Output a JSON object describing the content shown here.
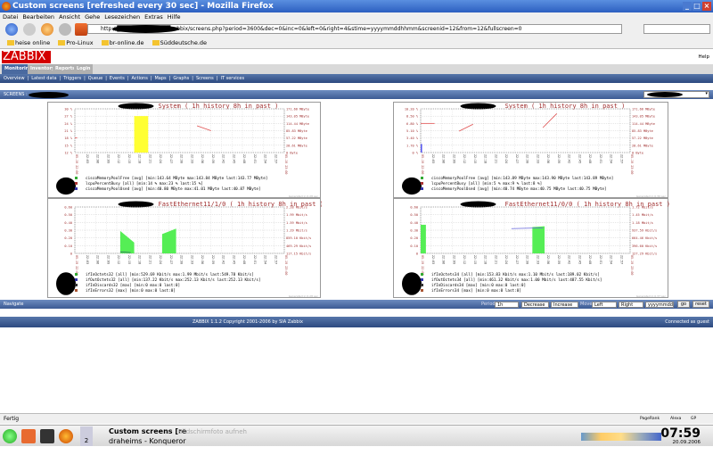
{
  "window": {
    "title": "Custom screens [refreshed every 30 sec] - Mozilla Firefox",
    "minimize": "_",
    "maximize": "□",
    "close": "×"
  },
  "menu": [
    "Datei",
    "Bearbeiten",
    "Ansicht",
    "Gehe",
    "Lesezeichen",
    "Extras",
    "Hilfe"
  ],
  "url": "http://█████████████zabbix/screens.php?period=3600&dec=0&inc=0&left=0&right=4&stime=yyyymmddhhmm&screenid=12&from=12&fullscreen=0",
  "bookmarks": [
    "heise online",
    "Pro-Linux",
    "br-online.de",
    "Süddeutsche.de"
  ],
  "zabbix": {
    "logo": "ZABBIX",
    "help": "Help",
    "tabs": [
      "Monitoring",
      "Inventory",
      "Reports",
      "Login"
    ],
    "submenu": [
      "Overview",
      "Latest data",
      "Triggers",
      "Queue",
      "Events",
      "Actions",
      "Maps",
      "Graphs",
      "Screens",
      "IT services"
    ],
    "screens_label": "SCREENS :",
    "navigate": "Navigate",
    "period_label": "Period",
    "period": "1h",
    "decrease": "Decrease",
    "increase": "Increase",
    "move_label": "Move",
    "left": "Left",
    "right": "Right",
    "stime": "yyyymmddhhmm",
    "go": "go",
    "reset": "reset",
    "footer": "ZABBIX 1.1.2 Copyright 2001-2006 by SIA Zabbix",
    "connected": "Connected as guest"
  },
  "graphs": [
    {
      "title": "System ( 1h history 8h in past )",
      "ylim": [
        12,
        30
      ],
      "left_axis": [
        "30 %",
        "27 %",
        "24 %",
        "21 %",
        "18 %",
        "15 %",
        "12 %"
      ],
      "right_axis": [
        "171.66 MByte",
        "143.05 MByte",
        "114.44 MByte",
        "85.83 MByte",
        "57.22 MByte",
        "28.61 MByte",
        "0 Byte"
      ],
      "x_start": "05.19 22:00",
      "x_end": "05.19 23:00",
      "marks": [
        {
          "kind": "area",
          "color": "#ffff33",
          "points": [
            [
              17,
              27
            ],
            [
              21,
              27
            ]
          ]
        },
        {
          "kind": "line",
          "color": "#e05050",
          "points": [
            [
              35,
              23
            ],
            [
              39,
              21
            ]
          ]
        },
        {
          "kind": "line",
          "color": "#e05050",
          "points": [
            [
              0,
              18
            ],
            [
              0.7,
              18
            ]
          ]
        }
      ],
      "legend": [
        {
          "color": "#33aa33",
          "text": "ciscoMemoryPoolFree [avg] [min:143.64 MByte max:143.84 MByte last:143.77 MByte]"
        },
        {
          "color": "#aa3333",
          "text": "lcpuPercentBusy     [all] [min:14 % max:23 % last:15 %]"
        },
        {
          "color": "#3333aa",
          "text": "ciscoMemoryPoolUsed [avg] [min:40.80 MByte max:41.01 MByte last:40.87 MByte]"
        }
      ],
      "generated": "Generated in 0.28 sec"
    },
    {
      "title": "System ( 1h history 8h in past )",
      "ylim": [
        0,
        10.2
      ],
      "left_axis": [
        "10.20 %",
        "8.50 %",
        "6.80 %",
        "5.10 %",
        "3.40 %",
        "1.70 %",
        "0 %"
      ],
      "right_axis": [
        "171.66 MByte",
        "143.05 MByte",
        "114.44 MByte",
        "85.83 MByte",
        "57.22 MByte",
        "28.61 MByte",
        "0 Byte"
      ],
      "x_start": "05.19 22:00",
      "x_end": "05.19 23:00",
      "marks": [
        {
          "kind": "area",
          "color": "#5555ee",
          "points": [
            [
              0,
              2
            ],
            [
              0.4,
              2
            ]
          ]
        },
        {
          "kind": "line",
          "color": "#e05050",
          "points": [
            [
              0,
              6.8
            ],
            [
              4,
              6.8
            ]
          ]
        },
        {
          "kind": "line",
          "color": "#e05050",
          "points": [
            [
              11,
              5
            ],
            [
              15,
              6.6
            ]
          ]
        },
        {
          "kind": "line",
          "color": "#e05050",
          "points": [
            [
              35,
              5.8
            ],
            [
              39,
              9.1
            ]
          ]
        }
      ],
      "legend": [
        {
          "color": "#33aa33",
          "text": "ciscoMemoryPoolFree [avg] [min:143.89 MByte max:143.90 MByte last:143.89 MByte]"
        },
        {
          "color": "#aa3333",
          "text": "lcpuPercentBusy     [all] [min:5 % max:9 % last:8 %]"
        },
        {
          "color": "#3333aa",
          "text": "ciscoMemoryPoolUsed [avg] [min:40.74 MByte max:40.75 MByte last:40.75 MByte]"
        }
      ],
      "generated": "Generated in 0.30 sec"
    },
    {
      "title": "FastEthernet11/1/0 ( 1h history 8h in past )",
      "ylim": [
        0,
        0.6
      ],
      "left_axis": [
        "0.60",
        "0.50",
        "0.40",
        "0.30",
        "0.20",
        "0.10",
        "0"
      ],
      "right_axis": [
        "2.28 Mbit/s",
        "1.99 Mbit/s",
        "1.59 Mbit/s",
        "1.29 Mbit/s",
        "859.10 Kbit/s",
        "469.29 Kbit/s",
        "117.15 Kbit/s"
      ],
      "x_start": "05.19 22:00",
      "x_end": "05.19 23:00",
      "marks": [
        {
          "kind": "area",
          "color": "#55ee55",
          "points": [
            [
              13,
              0.29
            ],
            [
              17,
              0.14
            ]
          ]
        },
        {
          "kind": "area",
          "color": "#55ee55",
          "points": [
            [
              25,
              0.25
            ],
            [
              29,
              0.32
            ]
          ]
        },
        {
          "kind": "line",
          "color": "#336666",
          "points": [
            [
              13,
              0.02
            ],
            [
              16,
              0.01
            ]
          ]
        }
      ],
      "legend": [
        {
          "color": "#33aa33",
          "text": "ifInOctets32    [all] [min:529.69 Kbit/s max:1.99 Mbit/s last:549.78 Kbit/s]"
        },
        {
          "color": "#3333aa",
          "text": "ifOutOctets32   [all] [min:137.22 Kbit/s max:252.13 Kbit/s last:252.13 Kbit/s]"
        },
        {
          "color": "#333333",
          "text": "ifInDiscards32 [max] [min:0 max:0 last:0]"
        },
        {
          "color": "#aa5533",
          "text": "ifInErrors32    [max] [min:0 max:0 last:0]"
        }
      ],
      "generated": "Generated in 0.28 sec"
    },
    {
      "title": "FastEthernet11/0/0 ( 1h history 8h in past )",
      "ylim": [
        0,
        0.6
      ],
      "left_axis": [
        "0.60",
        "0.50",
        "0.40",
        "0.30",
        "0.20",
        "0.10",
        "0"
      ],
      "right_axis": [
        "1.72 Mbit/s",
        "1.45 Mbit/s",
        "1.18 Mbit/s",
        "937.59 Kbit/s",
        "664.46 Kbit/s",
        "396.60 Kbit/s",
        "127.29 Kbit/s"
      ],
      "x_start": "05.19 22:00",
      "x_end": "05.19 23:00",
      "marks": [
        {
          "kind": "area",
          "color": "#55ee55",
          "points": [
            [
              0,
              0.37
            ],
            [
              1.5,
              0.37
            ]
          ]
        },
        {
          "kind": "area",
          "color": "#55ee55",
          "points": [
            [
              32,
              0.34
            ],
            [
              35.5,
              0.35
            ]
          ]
        },
        {
          "kind": "line",
          "color": "#6666dd",
          "points": [
            [
              26,
              0.32
            ],
            [
              35,
              0.33
            ]
          ]
        }
      ],
      "legend": [
        {
          "color": "#33aa33",
          "text": "ifInOctets34    [all] [min:153.83 Kbit/s max:1.10 Mbit/s last:189.02 Kbit/s]"
        },
        {
          "color": "#3333aa",
          "text": "ifOutOctets34   [all] [min:461.32 Kbit/s max:1.00 Mbit/s last:487.55 Kbit/s]"
        },
        {
          "color": "#333333",
          "text": "ifInDiscards34 [max] [min:0 max:0 last:0]"
        },
        {
          "color": "#aa5533",
          "text": "ifInErrors34    [max] [min:0 max:0 last:0]"
        }
      ],
      "generated": "Generated in 0.37 sec"
    }
  ],
  "x_ticks": [
    "22:00",
    "22:03",
    "22:06",
    "22:09",
    "22:12",
    "22:15",
    "22:18",
    "22:21",
    "22:24",
    "22:27",
    "22:30",
    "22:33",
    "22:36",
    "22:39",
    "22:42",
    "22:45",
    "22:48",
    "22:51",
    "22:54",
    "22:57",
    "23:00"
  ],
  "status": "Fertig",
  "statusbar_right": [
    "PageRank",
    "Alexa",
    "GP"
  ],
  "taskbar": {
    "desktop": "2",
    "tasks": [
      "Custom screens [re",
      "Bildschirmfoto aufneh",
      "draheims - Konqueror"
    ],
    "clock": "07:59",
    "date": "20.09.2006"
  }
}
